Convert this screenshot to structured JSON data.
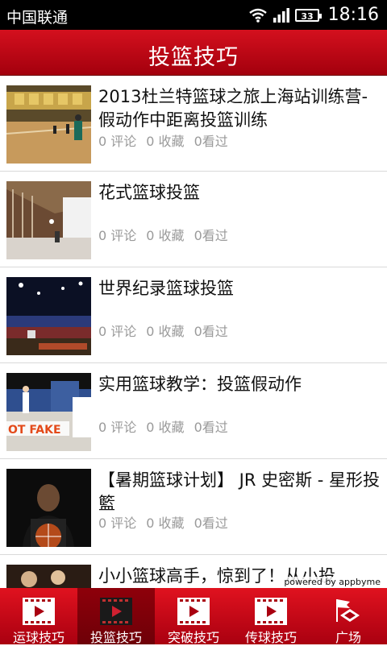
{
  "status": {
    "carrier": "中国联通",
    "battery": "33",
    "time": "18:16"
  },
  "header": {
    "title": "投篮技巧"
  },
  "items": [
    {
      "title": "2013杜兰特篮球之旅上海站训练营-假动作中距离投篮训练",
      "comments": "0 评论",
      "favorites": "0 收藏",
      "views": "0看过"
    },
    {
      "title": "花式篮球投篮",
      "comments": "0 评论",
      "favorites": "0 收藏",
      "views": "0看过"
    },
    {
      "title": "世界纪录篮球投篮",
      "comments": "0 评论",
      "favorites": "0 收藏",
      "views": "0看过"
    },
    {
      "title": "实用篮球教学：投篮假动作",
      "comments": "0 评论",
      "favorites": "0 收藏",
      "views": "0看过"
    },
    {
      "title": "【暑期篮球计划】 JR 史密斯 - 星形投籃",
      "comments": "0 评论",
      "favorites": "0 收藏",
      "views": "0看过"
    },
    {
      "title": "小小篮球高手，惊到了！从小投"
    }
  ],
  "thumb_text": {
    "fake": "OT FAKE"
  },
  "powered": "powered by appbyme",
  "tabs": [
    {
      "label": "运球技巧",
      "icon": "film-icon"
    },
    {
      "label": "投篮技巧",
      "icon": "film-icon"
    },
    {
      "label": "突破技巧",
      "icon": "film-icon"
    },
    {
      "label": "传球技巧",
      "icon": "film-icon"
    },
    {
      "label": "广场",
      "icon": "plaza-icon"
    }
  ],
  "colors": {
    "brand_red": "#c80a18",
    "meta_gray": "#9a9a9a"
  }
}
